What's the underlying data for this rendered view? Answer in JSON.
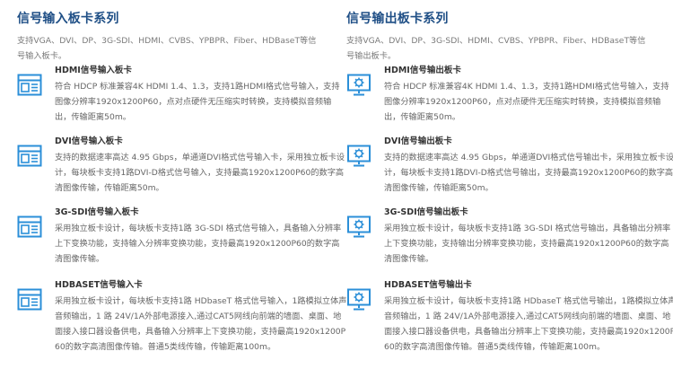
{
  "input": {
    "title": "信号输入板卡系列",
    "desc": "支持VGA、DVI、DP、3G-SDI、HDMI、CVBS、YPBPR、Fiber、HDBaseT等信号输入板卡。",
    "items": [
      {
        "name": "HDMI信号输入板卡",
        "text": "符合 HDCP 标准兼容4K HDMI 1.4、1.3，支持1路HDMI格式信号输入，支持图像分辨率1920x1200P60，点对点硬件无压缩实时转换，支持模拟音频输出，传输距离50m。"
      },
      {
        "name": "DVI信号输入板卡",
        "text": "支持的数据速率高达 4.95 Gbps，单通道DVI格式信号输入卡，采用独立板卡设计，每块板卡支持1路DVI-D格式信号输入，支持最高1920x1200P60的数字高清图像传输，传输距离50m。"
      },
      {
        "name": "3G-SDI信号输入板卡",
        "text": "采用独立板卡设计，每块板卡支持1路 3G-SDI 格式信号输入，具备输入分辨率上下变换功能，支持输入分辨率变换功能，支持最高1920x1200P60的数字高清图像传输。"
      },
      {
        "name": "HDBASET信号输入卡",
        "text": "采用独立板卡设计，每块板卡支持1路 HDbaseT 格式信号输入，1路模拟立体声音频输出，1 路 24V/1A外部电源接入,通过CAT5网线向前端的墙面、桌面、地面接入接口器设备供电，具备输入分辨率上下变换功能，支持最高1920x1200P60的数字高清图像传输。普通5类线传输，传输距离100m。"
      }
    ]
  },
  "output": {
    "title": "信号输出板卡系列",
    "desc": "支持VGA、DVI、DP、3G-SDI、HDMI、CVBS、YPBPR、Fiber、HDBaseT等信号输出板卡。",
    "items": [
      {
        "name": "HDMI信号输出板卡",
        "text": "符合 HDCP 标准兼容4K HDMI 1.4、1.3，支持1路HDMI格式信号输入，支持图像分辨率1920x1200P60，点对点硬件无压缩实时转换，支持模拟音频输出，传输距离50m。"
      },
      {
        "name": "DVI信号输出板卡",
        "text": "支持的数据速率高达 4.95 Gbps，单通道DVI格式信号输出卡，采用独立板卡设计，每块板卡支持1路DVI-D格式信号输出，支持最高1920x1200P60的数字高清图像传输，传输距离50m。"
      },
      {
        "name": "3G-SDI信号输出板卡",
        "text": "采用独立板卡设计，每块板卡支持1路 3G-SDI 格式信号输出，具备输出分辨率上下变换功能，支持输出分辨率变换功能，支持最高1920x1200P60的数字高清图像传输。"
      },
      {
        "name": "HDBASET信号输出卡",
        "text": "采用独立板卡设计，每块板卡支持1路 HDbaseT 格式信号输出，1路模拟立体声音频输出，1 路 24V/1A外部电源接入,通过CAT5网线向前端的墙面、桌面、地面接入接口器设备供电，具备输出分辨率上下变换功能，支持最高1920x1200P60的数字高清图像传输。普通5类线传输，传输距离100m。"
      }
    ]
  },
  "icons": {
    "input": "window-icon",
    "output": "monitor-gear-icon"
  },
  "colors": {
    "title": "#1f4f86",
    "icon": "#2b8fd8",
    "text": "#666666",
    "desc": "#7a7a7a"
  }
}
